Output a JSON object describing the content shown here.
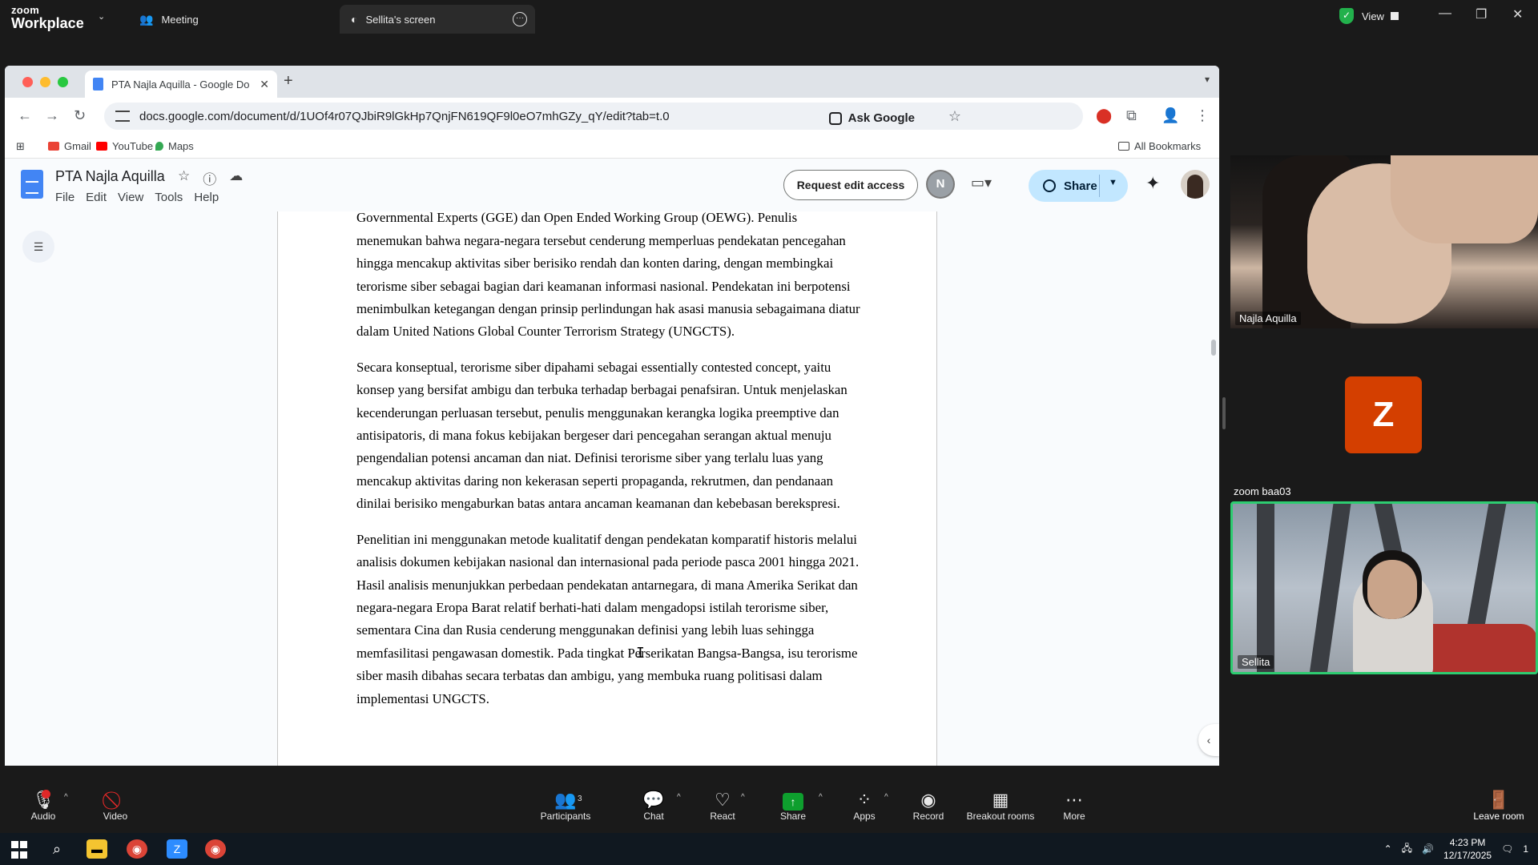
{
  "zoom": {
    "logo_line1": "zoom",
    "logo_line2": "Workplace",
    "tab_meeting": "Meeting",
    "tab_screen": "Sellita's screen",
    "view_label": "View",
    "accent": "#2ecc71"
  },
  "chrome": {
    "tab_title": "PTA Najla Aquilla - Google Do",
    "url": "docs.google.com/document/d/1UOf4r07QJbiR9lGkHp7QnjFN619QF9l0eO7mhGZy_qY/edit?tab=t.0",
    "ask_google": "Ask Google",
    "bookmarks": [
      "Gmail",
      "YouTube",
      "Maps"
    ],
    "all_bookmarks": "All Bookmarks"
  },
  "docs": {
    "title": "PTA Najla Aquilla",
    "menu": [
      "File",
      "Edit",
      "View",
      "Tools",
      "Help"
    ],
    "request_edit": "Request edit access",
    "avatar_initial": "N",
    "share_label": "Share",
    "paragraphs": [
      "diatur ... ... ... ... ... ... dinegosiasikan di tingkat multilateral melalui mekanisme Group of Governmental Experts (GGE) dan Open Ended Working Group (OEWG). Penulis menemukan bahwa negara-negara tersebut cenderung memperluas pendekatan pencegahan hingga mencakup aktivitas siber berisiko rendah dan konten daring, dengan membingkai terorisme siber sebagai bagian dari keamanan informasi nasional. Pendekatan ini berpotensi menimbulkan ketegangan dengan prinsip perlindungan hak asasi manusia sebagaimana diatur dalam United Nations Global Counter Terrorism Strategy (UNGCTS).",
      "Secara konseptual, terorisme siber dipahami sebagai essentially contested concept, yaitu konsep yang bersifat ambigu dan terbuka terhadap berbagai penafsiran. Untuk menjelaskan kecenderungan perluasan tersebut, penulis menggunakan kerangka logika preemptive dan antisipatoris, di mana fokus kebijakan bergeser dari pencegahan serangan aktual menuju pengendalian potensi ancaman dan niat. Definisi terorisme siber yang terlalu luas yang mencakup aktivitas daring non kekerasan seperti propaganda, rekrutmen, dan pendanaan dinilai berisiko mengaburkan batas antara ancaman keamanan dan kebebasan berekspresi.",
      "Penelitian ini menggunakan metode kualitatif dengan pendekatan komparatif historis melalui analisis dokumen kebijakan nasional dan internasional pada periode pasca 2001 hingga 2021. Hasil analisis menunjukkan perbedaan pendekatan antarnegara, di mana Amerika Serikat dan negara-negara Eropa Barat relatif berhati-hati dalam mengadopsi istilah terorisme siber, sementara Cina dan Rusia cenderung menggunakan definisi yang lebih luas sehingga memfasilitasi pengawasan domestik. Pada tingkat Perserikatan Bangsa-Bangsa, isu terorisme siber masih dibahas secara terbatas dan ambigu, yang membuka ruang politisasi dalam implementasi UNGCTS."
    ]
  },
  "participants": [
    {
      "name": "Najla Aquilla"
    },
    {
      "name": "zoom baa03",
      "initial": "Z",
      "color": "#d43f00"
    },
    {
      "name": "Sellita"
    }
  ],
  "toolbar": {
    "audio": "Audio",
    "video": "Video",
    "participants": "Participants",
    "participants_count": "3",
    "chat": "Chat",
    "react": "React",
    "share": "Share",
    "apps": "Apps",
    "record": "Record",
    "breakout": "Breakout rooms",
    "more": "More",
    "leave": "Leave room"
  },
  "taskbar": {
    "time": "4:23 PM",
    "date": "12/17/2025",
    "notification_count": "1"
  }
}
